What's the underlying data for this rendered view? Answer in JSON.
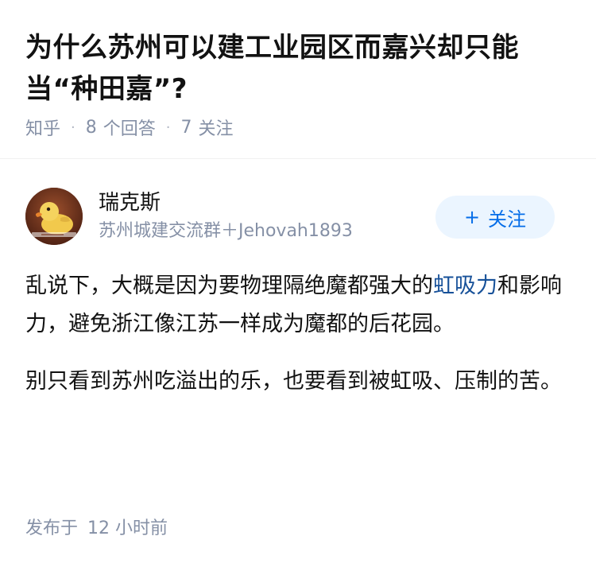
{
  "question": {
    "title": "为什么苏州可以建工业园区而嘉兴却只能当“种田嘉”?",
    "source": "知乎",
    "answer_count": "8",
    "answer_label": "个回答",
    "follow_count": "7",
    "follow_label": "关注"
  },
  "author": {
    "name": "瑞克斯",
    "bio": "苏州城建交流群＋Jehovah1893",
    "follow_button_label": "关注",
    "follow_button_icon": "plus-icon",
    "avatar_icon": "duck-avatar"
  },
  "answer": {
    "paragraph_1_before": "乱说下，大概是因为要物理隔绝魔都强大的",
    "paragraph_1_link": "虹吸力",
    "paragraph_1_after": "和影响力，避免浙江像江苏一样成为魔都的后花园。",
    "paragraph_2": "别只看到苏州吃溢出的乐，也要看到被虹吸、压制的苦。"
  },
  "publish": {
    "label": "发布于",
    "time": "12 小时前"
  },
  "colors": {
    "meta_gray": "#8590a6",
    "link_blue": "#175199",
    "follow_blue": "#056de8",
    "follow_bg": "#ebf5ff"
  }
}
